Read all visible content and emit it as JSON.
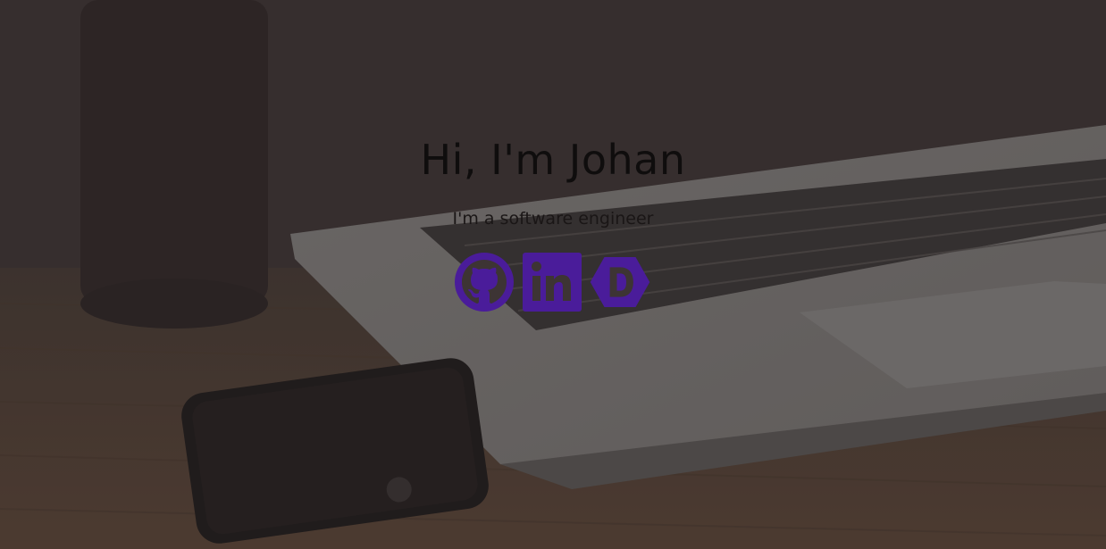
{
  "hero": {
    "title": "Hi, I'm Johan",
    "subtitle": "I'm a software engineer"
  },
  "social_links": [
    {
      "icon": "github-icon",
      "label": "GitHub"
    },
    {
      "icon": "linkedin-icon",
      "label": "LinkedIn"
    },
    {
      "icon": "dev-icon",
      "label": "Dev"
    }
  ],
  "colors": {
    "icon_accent": "#4a1c9a",
    "title_text": "#0f0d0d",
    "overlay": "#3d3333"
  }
}
